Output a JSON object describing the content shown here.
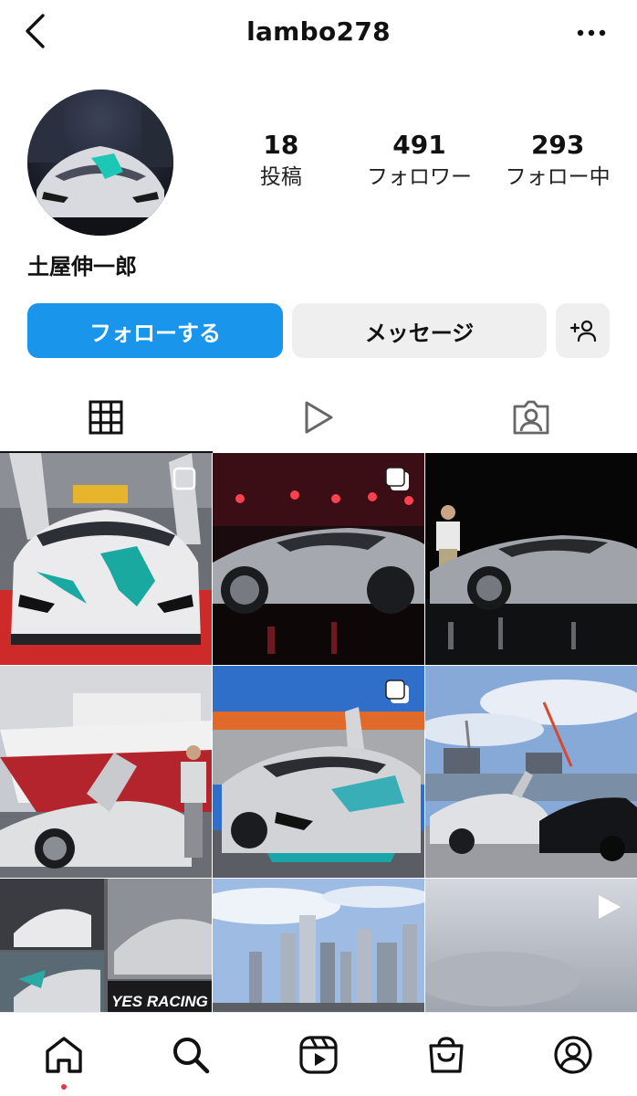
{
  "header": {
    "username": "lambo278",
    "back_icon": "chevron-left-icon",
    "more_icon": "more-horizontal-icon"
  },
  "profile": {
    "display_name": "土屋伸一郎",
    "stats": [
      {
        "value": "18",
        "label": "投稿"
      },
      {
        "value": "491",
        "label": "フォロワー"
      },
      {
        "value": "293",
        "label": "フォロー中"
      }
    ]
  },
  "actions": {
    "follow_label": "フォローする",
    "message_label": "メッセージ",
    "suggest_icon": "add-person-icon"
  },
  "tabs": [
    {
      "icon": "grid-icon",
      "active": true
    },
    {
      "icon": "reels-play-icon",
      "active": false
    },
    {
      "icon": "tagged-person-icon",
      "active": false
    }
  ],
  "grid": {
    "posts": [
      {
        "type": "multi"
      },
      {
        "type": "multi"
      },
      {
        "type": "single"
      },
      {
        "type": "single"
      },
      {
        "type": "multi"
      },
      {
        "type": "single"
      },
      {
        "type": "single"
      },
      {
        "type": "single"
      },
      {
        "type": "video"
      }
    ],
    "overlay_text": "YES RACING"
  },
  "bottom_nav": [
    {
      "icon": "home-icon",
      "active": true
    },
    {
      "icon": "search-icon",
      "active": false
    },
    {
      "icon": "reels-icon",
      "active": false
    },
    {
      "icon": "shop-icon",
      "active": false
    },
    {
      "icon": "profile-icon",
      "active": false
    }
  ],
  "colors": {
    "follow_button": "#1a95ec",
    "secondary_button": "#efefef",
    "notification_dot": "#e8344b"
  }
}
